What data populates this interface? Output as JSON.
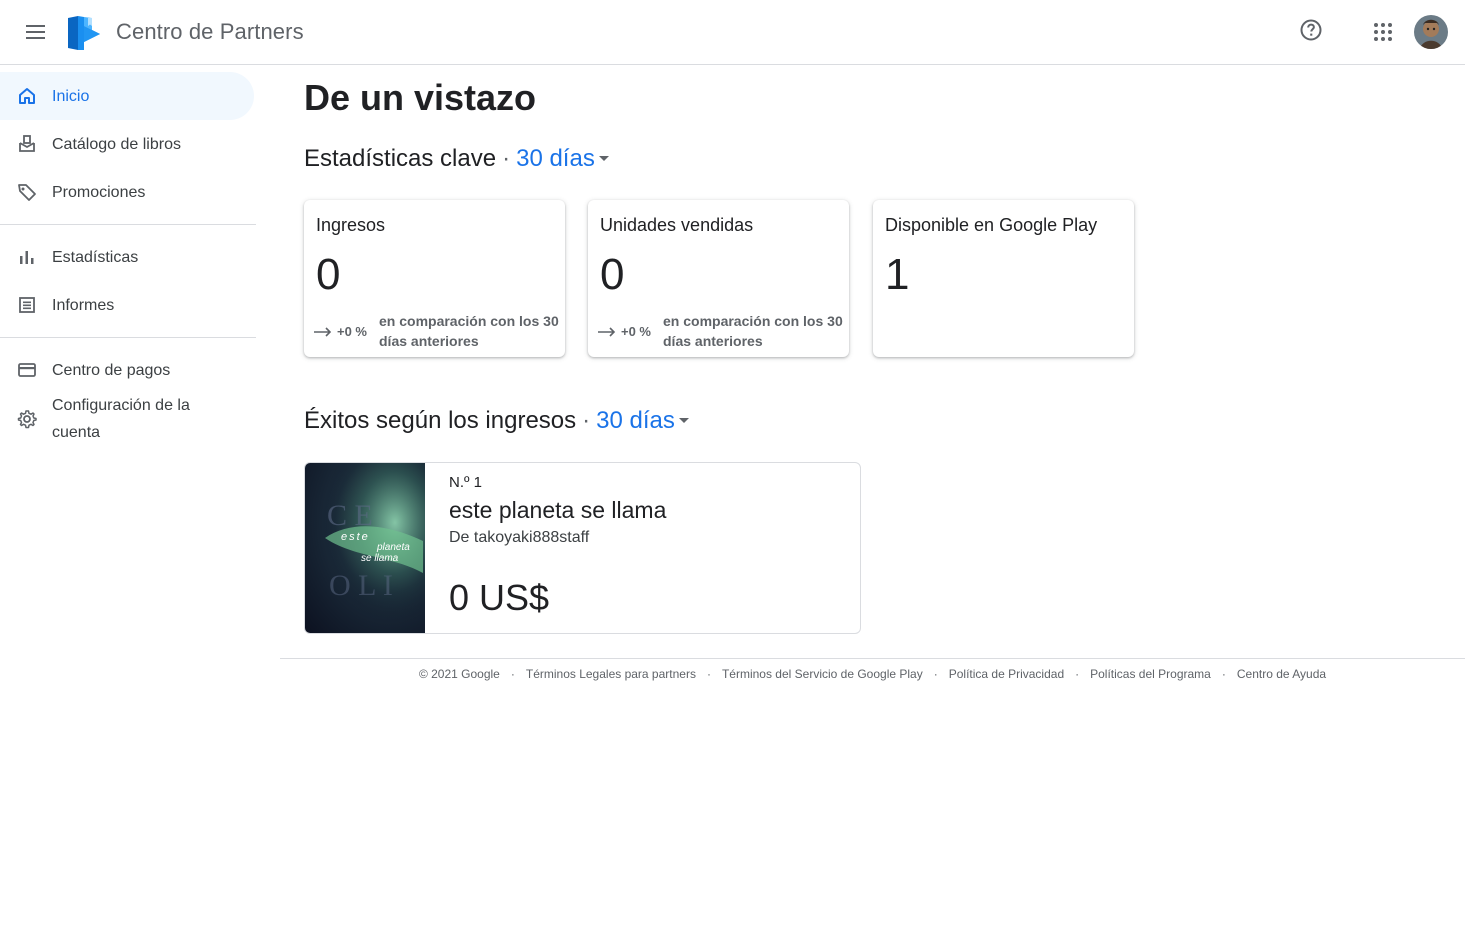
{
  "header": {
    "app_title": "Centro de Partners"
  },
  "sidebar": {
    "items": [
      {
        "label": "Inicio",
        "icon": "home-icon"
      },
      {
        "label": "Catálogo de libros",
        "icon": "book-catalog-icon"
      },
      {
        "label": "Promociones",
        "icon": "tag-icon"
      },
      {
        "label": "Estadísticas",
        "icon": "bar-chart-icon"
      },
      {
        "label": "Informes",
        "icon": "report-icon"
      },
      {
        "label": "Centro de pagos",
        "icon": "credit-card-icon"
      },
      {
        "label": "Configuración de la cuenta",
        "icon": "gear-icon"
      }
    ]
  },
  "main": {
    "page_title": "De un vistazo",
    "key_stats": {
      "title": "Estadísticas clave",
      "separator": "·",
      "range": "30 días"
    },
    "cards": [
      {
        "title": "Ingresos",
        "value": "0",
        "trend": "+0 %",
        "compare": "en comparación con los 30 días anteriores"
      },
      {
        "title": "Unidades vendidas",
        "value": "0",
        "trend": "+0 %",
        "compare": "en comparación con los 30 días anteriores"
      },
      {
        "title": "Disponible en Google Play",
        "value": "1"
      }
    ],
    "top_sellers": {
      "title": "Éxitos según los ingresos",
      "separator": "·",
      "range": "30 días",
      "item": {
        "rank": "N.º 1",
        "title": "este planeta se llama",
        "author": "De takoyaki888staff",
        "revenue": "0 US$",
        "cover_text": [
          "este",
          "planeta",
          "se llama"
        ]
      }
    }
  },
  "footer": {
    "copyright": "© 2021 Google",
    "links": [
      "Términos Legales para partners",
      "Términos del Servicio de Google Play",
      "Política de Privacidad",
      "Políticas del Programa",
      "Centro de Ayuda"
    ],
    "separator": "·"
  },
  "colors": {
    "accent": "#1a73e8",
    "active_bg": "#f1f8fe",
    "divider": "#dadce0",
    "text_secondary": "#5f6368"
  }
}
